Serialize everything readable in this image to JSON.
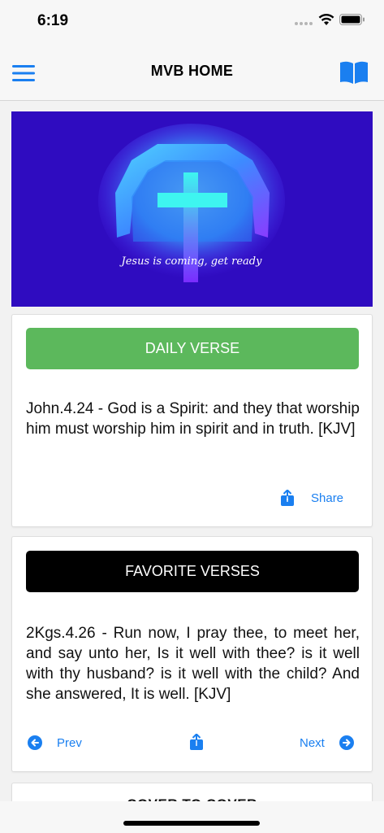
{
  "status_bar": {
    "time": "6:19"
  },
  "nav": {
    "title": "MVB HOME",
    "menu_icon": "hamburger-menu-icon",
    "book_icon": "open-book-icon"
  },
  "banner": {
    "caption": "Jesus is coming, get ready",
    "background": "#2f0cc0",
    "glow": "#5fdcff"
  },
  "daily": {
    "header": "DAILY VERSE",
    "header_color": "#5cb85c",
    "verse": "John.4.24 - God is a Spirit: and they that worship him must worship him in spirit and in truth. [KJV]",
    "share_label": "Share"
  },
  "favorites": {
    "header": "FAVORITE VERSES",
    "header_color": "#000000",
    "verse": "2Kgs.4.26 - Run now, I pray thee, to meet her, and say unto her, Is it well with thee? is it well with thy husband? is it well with the child? And she answered, It is well.  [KJV]",
    "prev_label": "Prev",
    "next_label": "Next"
  },
  "cover": {
    "title": "COVER TO COVER"
  },
  "accent": "#1a7ff0"
}
